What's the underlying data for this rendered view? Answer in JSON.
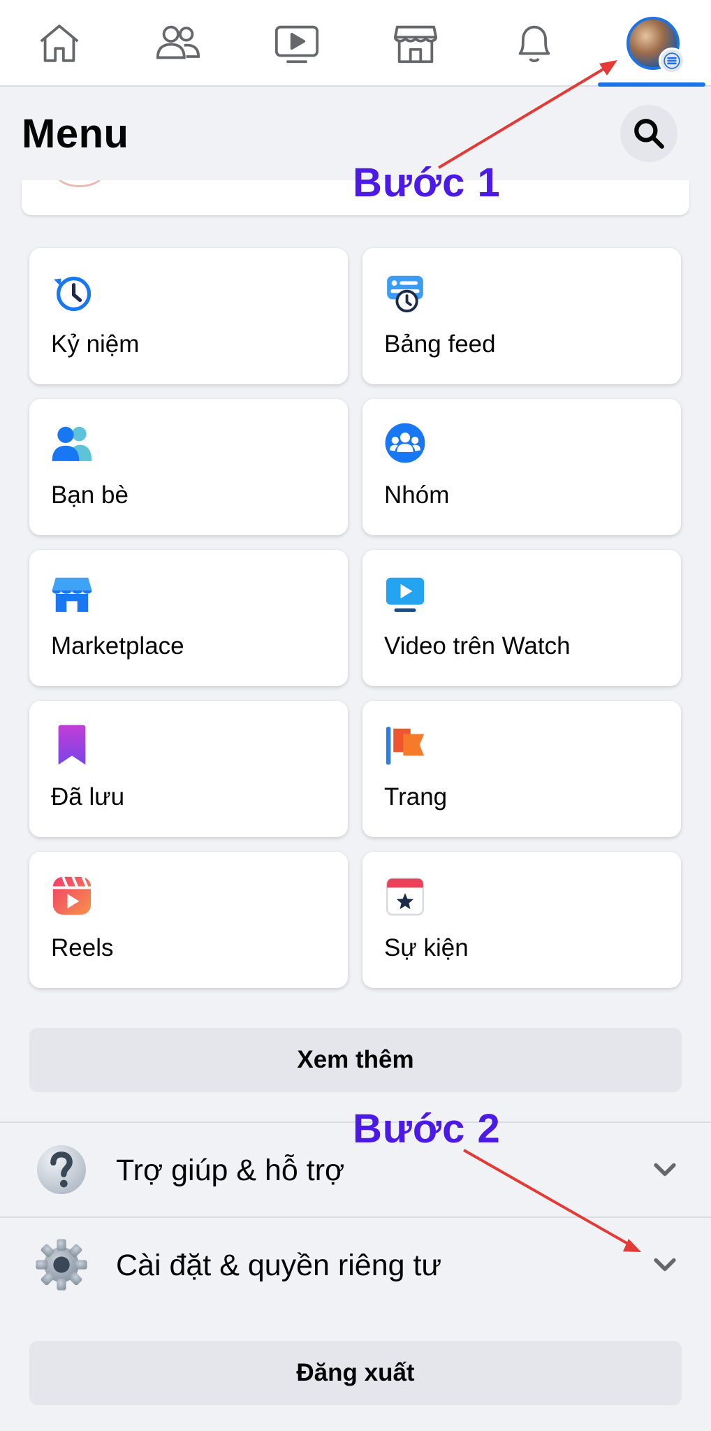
{
  "nav": {
    "items": [
      {
        "icon": "home-icon"
      },
      {
        "icon": "friends-icon"
      },
      {
        "icon": "watch-icon"
      },
      {
        "icon": "marketplace-icon"
      },
      {
        "icon": "bell-icon"
      },
      {
        "icon": "profile-avatar",
        "active": true
      }
    ],
    "active_color": "#1b74e4"
  },
  "header": {
    "title": "Menu",
    "search_icon": "search-icon"
  },
  "annotations": {
    "step1": "Bước 1",
    "step2": "Bước 2",
    "label_color": "#4b1ae6",
    "arrow_color": "#e53935"
  },
  "shortcuts": [
    {
      "label": "Kỷ niệm",
      "icon": "memories-icon"
    },
    {
      "label": "Bảng feed",
      "icon": "feeds-icon"
    },
    {
      "label": "Bạn bè",
      "icon": "friends-icon"
    },
    {
      "label": "Nhóm",
      "icon": "groups-icon"
    },
    {
      "label": "Marketplace",
      "icon": "marketplace-icon"
    },
    {
      "label": "Video trên Watch",
      "icon": "watch-video-icon"
    },
    {
      "label": "Đã lưu",
      "icon": "saved-icon"
    },
    {
      "label": "Trang",
      "icon": "pages-flag-icon"
    },
    {
      "label": "Reels",
      "icon": "reels-icon"
    },
    {
      "label": "Sự kiện",
      "icon": "events-icon"
    }
  ],
  "see_more": "Xem thêm",
  "sections": [
    {
      "label": "Trợ giúp & hỗ trợ",
      "icon": "help-icon"
    },
    {
      "label": "Cài đặt & quyền riêng tư",
      "icon": "gear-icon"
    }
  ],
  "logout": "Đăng xuất"
}
